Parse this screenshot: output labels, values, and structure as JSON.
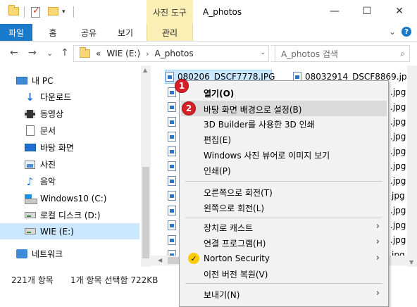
{
  "titlebar": {
    "context_tab_group": "사진 도구",
    "title": "A_photos",
    "minimize": "—",
    "maximize": "☐",
    "close": "✕"
  },
  "ribbon": {
    "tabs": [
      "파일",
      "홈",
      "공유",
      "보기",
      "관리"
    ],
    "expand": "⌄",
    "help": "?"
  },
  "address": {
    "back": "←",
    "forward": "→",
    "recent": "⌄",
    "up": "↑",
    "overflow": "«",
    "crumbs": [
      "WIE (E:)",
      "A_photos"
    ],
    "dropdown": "⌄",
    "refresh": "↻",
    "search_placeholder": "A_photos 검색",
    "search_icon": "search-icon"
  },
  "nav": {
    "items": [
      {
        "label": "내 PC",
        "icon": "computer-icon"
      },
      {
        "label": "다운로드",
        "icon": "download-icon"
      },
      {
        "label": "동영상",
        "icon": "video-icon"
      },
      {
        "label": "문서",
        "icon": "document-icon"
      },
      {
        "label": "바탕 화면",
        "icon": "desktop-icon"
      },
      {
        "label": "사진",
        "icon": "pictures-icon"
      },
      {
        "label": "음악",
        "icon": "music-icon"
      },
      {
        "label": "Windows10 (C:)",
        "icon": "windows-drive-icon"
      },
      {
        "label": "로컬 디스크 (D:)",
        "icon": "drive-icon"
      },
      {
        "label": "WIE (E:)",
        "icon": "drive-icon",
        "selected": true
      },
      {
        "label": "네트워크",
        "icon": "network-icon"
      }
    ]
  },
  "files": {
    "col1": [
      "080206_DSCF7778.JPG"
    ],
    "col2": [
      "08032914_DSCF8869.jpg",
      ".jpg",
      ".jpg",
      ".jpg",
      ".jpg",
      ".jpg",
      ".jpg",
      ".jpg",
      "jpg",
      ".jpg",
      ".jpg",
      ".jpg",
      "jpg"
    ]
  },
  "status": {
    "count": "221개 항목",
    "selection": "1개 항목 선택함 722KB"
  },
  "context_menu": {
    "items": [
      {
        "label": "열기(O)",
        "bold": true
      },
      {
        "label": "바탕 화면 배경으로 설정(B)",
        "highlighted": true
      },
      {
        "label": "3D Builder를 사용한 3D 인쇄"
      },
      {
        "label": "편집(E)"
      },
      {
        "label": "Windows 사진 뷰어로 이미지 보기"
      },
      {
        "label": "인쇄(P)"
      },
      {
        "label": "오른쪽으로 회전(T)"
      },
      {
        "label": "왼쪽으로 회전(L)"
      },
      {
        "label": "장치로 캐스트",
        "submenu": true
      },
      {
        "label": "연결 프로그램(H)",
        "submenu": true
      },
      {
        "label": "Norton Security",
        "submenu": true,
        "icon": "norton-check-icon"
      },
      {
        "label": "이전 버전 복원(V)"
      },
      {
        "label": "보내기(N)",
        "submenu": true
      }
    ],
    "submenu_arrow": "›",
    "norton_mark": "✓"
  },
  "badges": [
    "1",
    "2"
  ],
  "colors": {
    "file_tab": "#1979ca",
    "context_tab": "#fbefb5",
    "selection": "#cce8ff",
    "badge": "#d61f26",
    "menu_bg": "#f2f2f2"
  }
}
